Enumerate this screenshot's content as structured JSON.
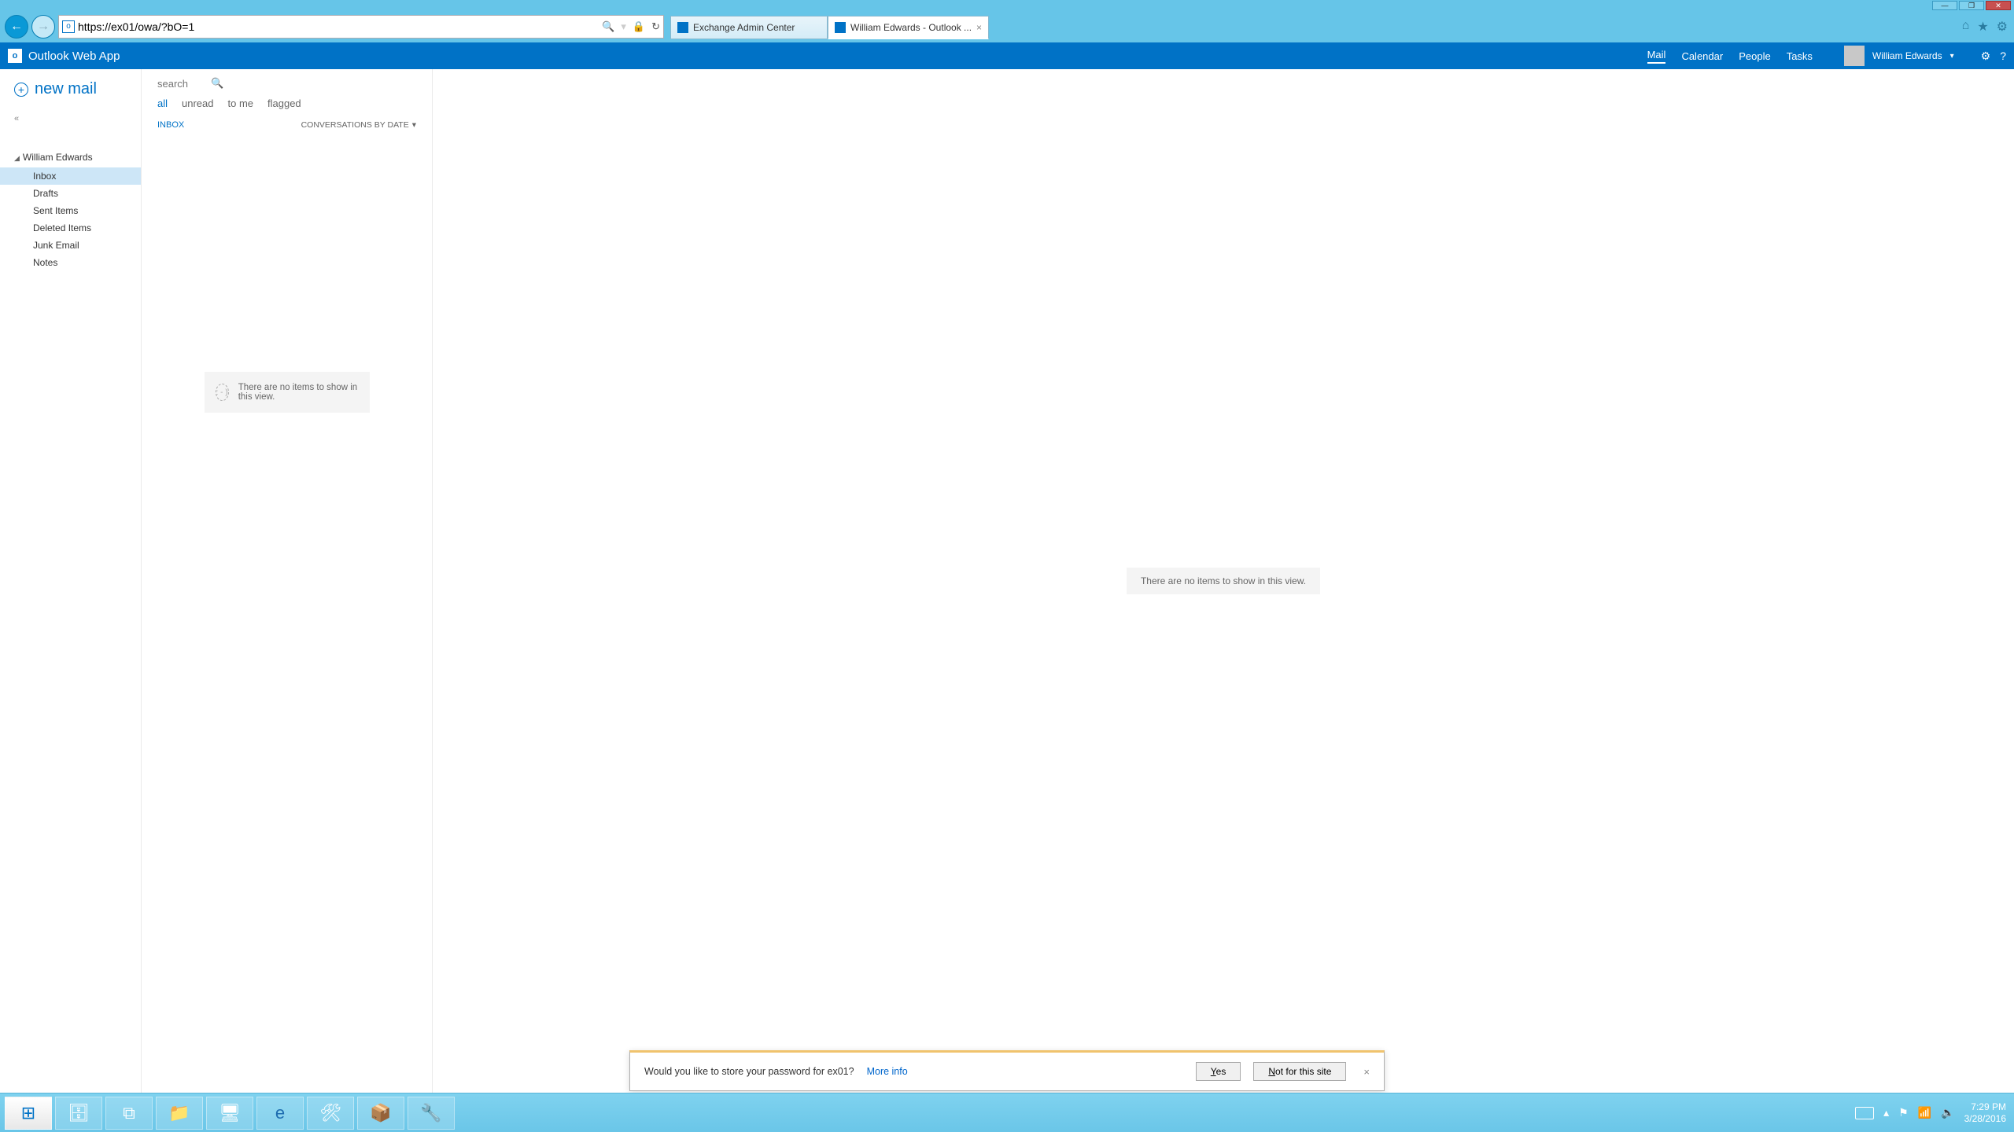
{
  "window": {
    "minimize": "—",
    "maximize": "❐",
    "close": "✕"
  },
  "ie": {
    "url": "https://ex01/owa/?bO=1",
    "search_hint": "🔍",
    "lock": "🔒",
    "refresh": "↻",
    "tabs": [
      {
        "title": "Exchange Admin Center"
      },
      {
        "title": "William Edwards - Outlook ..."
      }
    ],
    "home": "⌂",
    "fav": "★",
    "gear": "⚙"
  },
  "owa": {
    "app_title": "Outlook Web App",
    "nav": {
      "mail": "Mail",
      "calendar": "Calendar",
      "people": "People",
      "tasks": "Tasks"
    },
    "user": "William Edwards",
    "gear": "⚙",
    "help": "?",
    "new_mail": "new mail",
    "collapse": "«",
    "account": "William Edwards",
    "folders": [
      {
        "label": "Inbox",
        "selected": true
      },
      {
        "label": "Drafts"
      },
      {
        "label": "Sent Items"
      },
      {
        "label": "Deleted Items"
      },
      {
        "label": "Junk Email"
      },
      {
        "label": "Notes"
      }
    ],
    "search_placeholder": "search",
    "filters": {
      "all": "all",
      "unread": "unread",
      "tome": "to me",
      "flagged": "flagged"
    },
    "list_header": "INBOX",
    "sort_label": "CONVERSATIONS BY DATE",
    "empty_list": "There are no items to show in this view.",
    "empty_face": ": - )",
    "empty_reading": "There are no items to show in this view."
  },
  "pwbar": {
    "text": "Would you like to store your password for ex01?",
    "more": "More info",
    "yes": "Yes",
    "not": "Not for this site",
    "close": "×"
  },
  "taskbar": {
    "icons": [
      "⊞",
      "🗄",
      "⧉",
      "📁",
      "🖥",
      "e",
      "🛠",
      "📦",
      "🔧"
    ],
    "time": "7:29 PM",
    "date": "3/28/2016"
  }
}
